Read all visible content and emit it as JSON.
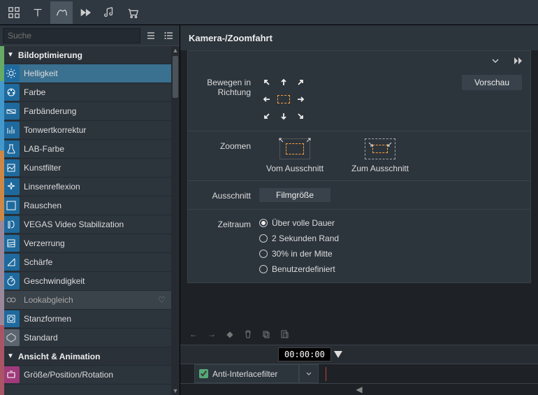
{
  "search": {
    "placeholder": "Suche"
  },
  "categories": {
    "cat1": "Bildoptimierung",
    "cat2": "Ansicht & Animation"
  },
  "items": {
    "helligkeit": "Helligkeit",
    "farbe": "Farbe",
    "farbaenderung": "Farbänderung",
    "tonwert": "Tonwertkorrektur",
    "lab": "LAB-Farbe",
    "kunst": "Kunstfilter",
    "linse": "Linsenreflexion",
    "rauschen": "Rauschen",
    "vegas": "VEGAS Video Stabilization",
    "verzerrung": "Verzerrung",
    "schaerfe": "Schärfe",
    "geschw": "Geschwindigkeit",
    "look": "Lookabgleich",
    "stanz": "Stanzformen",
    "standard": "Standard",
    "groesse": "Größe/Position/Rotation"
  },
  "panel": {
    "title": "Kamera-/Zoomfahrt",
    "move_label": "Bewegen in Richtung",
    "preview_btn": "Vorschau",
    "zoom_label": "Zoomen",
    "zoom_from": "Vom Ausschnitt",
    "zoom_to": "Zum Ausschnitt",
    "crop_label": "Ausschnitt",
    "crop_btn": "Filmgröße",
    "time_label": "Zeitraum",
    "radio1": "Über volle Dauer",
    "radio2": "2 Sekunden Rand",
    "radio3": "30% in der Mitte",
    "radio4": "Benutzerdefiniert"
  },
  "timeline": {
    "time": "00:00:00",
    "filter_label": "Anti-Interlacefilter"
  }
}
